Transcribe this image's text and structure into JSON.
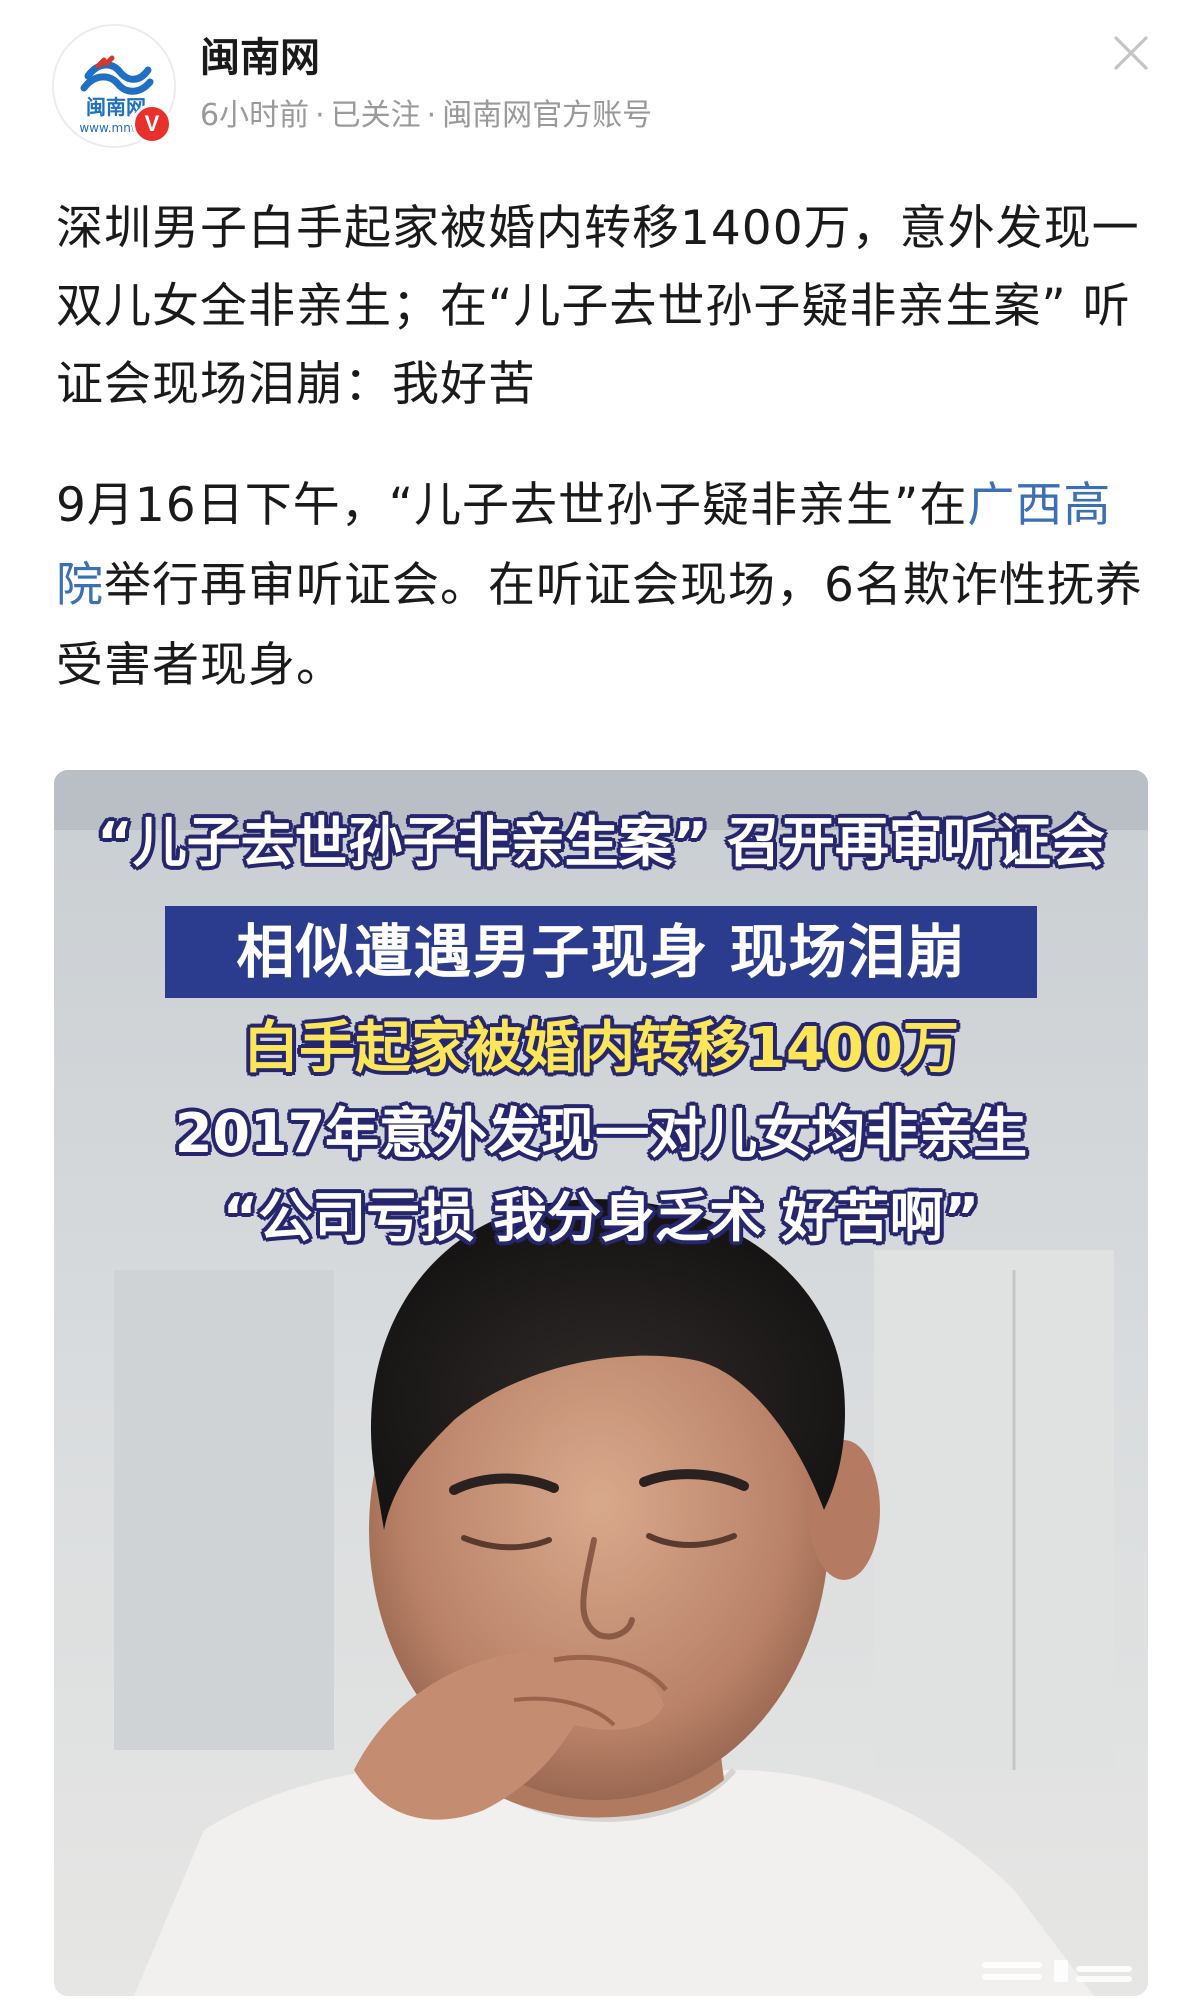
{
  "header": {
    "author_name": "闽南网",
    "avatar_logo_text": "闽南网",
    "avatar_logo_url_text": "www.mnw",
    "verified_badge": "V",
    "meta": {
      "time": "6小时前",
      "follow_status": "已关注",
      "account_type": "闽南网官方账号",
      "separator": "·"
    },
    "close_icon": "close-icon"
  },
  "article": {
    "title": "深圳男子白手起家被婚内转移1400万，意外发现一双儿女全非亲生；在“儿子去世孙子疑非亲生案” 听证会现场泪崩：我好苦",
    "body_before_link": "9月16日下午，“儿子去世孙子疑非亲生”在",
    "link_text": "广西高院",
    "body_after_link": "举行再审听证会。在听证会现场，6名欺诈性抚养受害者现身。"
  },
  "image": {
    "captions": {
      "line1": "“儿子去世孙子非亲生案” 召开再审听证会",
      "line2": "相似遭遇男子现身 现场泪崩",
      "line3": "白手起家被婚内转移1400万",
      "line4": "2017年意外发现一对儿女均非亲生",
      "line5": "“公司亏损 我分身乏术 好苦啊”"
    },
    "colors": {
      "caption_banner": "#2b3c8f",
      "caption_highlight": "#fbe65a",
      "caption_outline": "#26266e"
    }
  },
  "theme": {
    "link_color": "#3b6fb6",
    "verified_color": "#e8302c",
    "meta_color": "#9a9a9a"
  }
}
